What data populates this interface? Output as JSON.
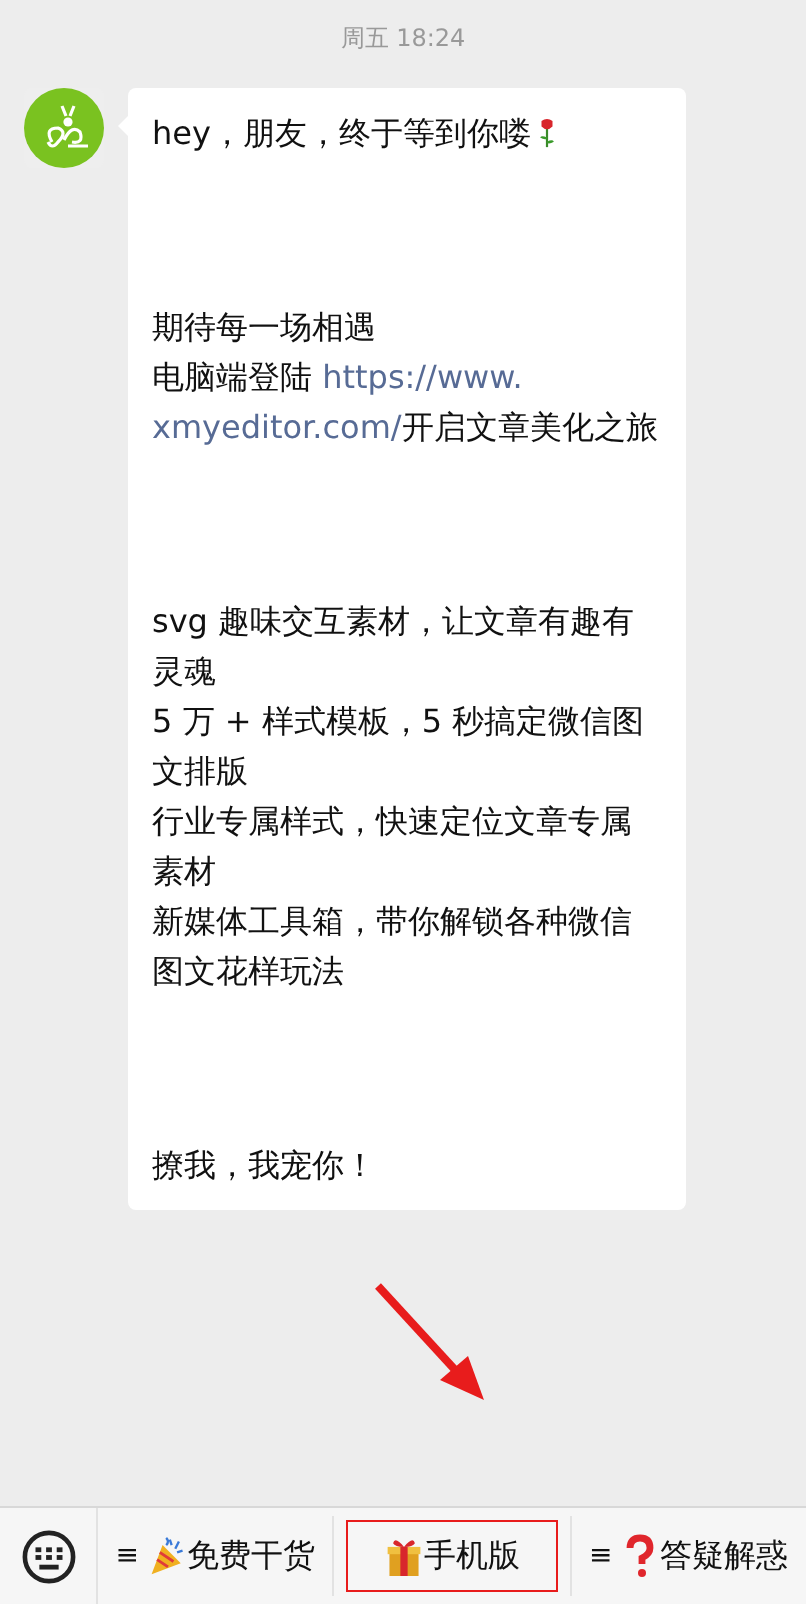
{
  "timestamp": "周五 18:24",
  "message": {
    "blocks": [
      {
        "paragraphs": [
          {
            "text": "hey，朋友，终于等到你喽",
            "kind": "rose"
          }
        ]
      },
      {
        "paragraphs": [
          {
            "text": "期待每一场相遇"
          },
          {
            "kind": "lines",
            "lines": [
              [
                {
                  "kind": "text",
                  "text": "电脑端登陆 "
                },
                {
                  "kind": "link",
                  "text": "https://www."
                }
              ],
              [
                {
                  "kind": "link",
                  "text": "xmyeditor.com/"
                },
                {
                  "kind": "text",
                  "text": "开启文章美化之旅"
                }
              ]
            ]
          }
        ]
      },
      {
        "paragraphs": [
          {
            "text": "svg 趣味交互素材，让文章有趣有灵魂"
          },
          {
            "text": "5 万 + 样式模板，5 秒搞定微信图文排版"
          },
          {
            "text": "行业专属样式，快速定位文章专属素材"
          },
          {
            "text": "新媒体工具箱，带你解锁各种微信图文花样玩法"
          }
        ]
      },
      {
        "paragraphs": [
          {
            "text": "撩我，我宠你！"
          }
        ]
      }
    ]
  },
  "pointer_arrow": true,
  "menu": [
    {
      "prefix": "≡",
      "kind": "party",
      "label": "免费干货",
      "highlighted": false
    },
    {
      "kind": "gift",
      "label": "手机版",
      "highlighted": true
    },
    {
      "prefix": "≡",
      "kind": "question",
      "label": "答疑解惑",
      "highlighted": false
    }
  ]
}
